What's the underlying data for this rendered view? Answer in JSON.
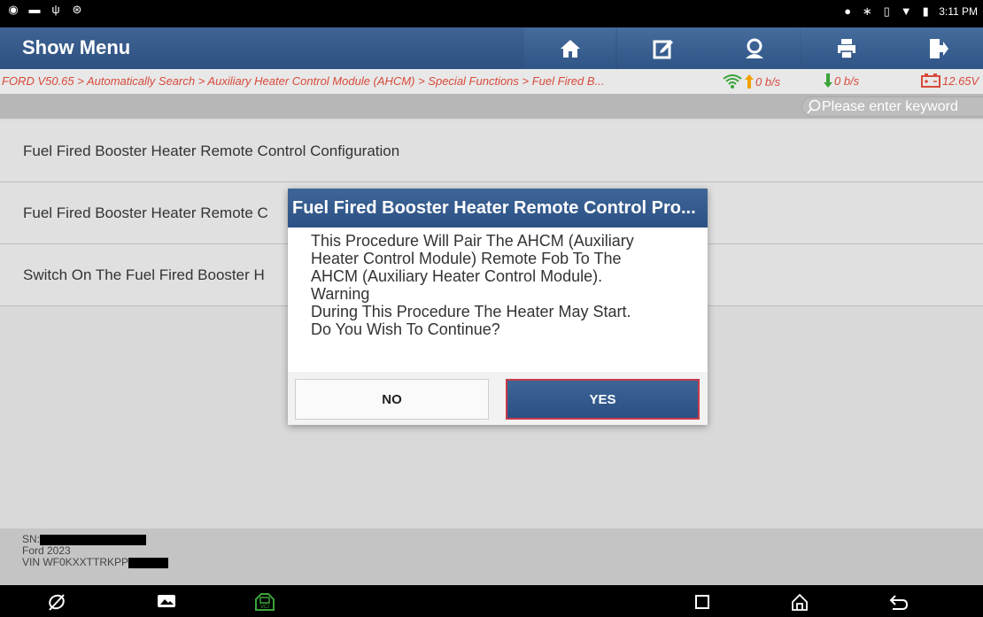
{
  "statusbar": {
    "time": "3:11 PM"
  },
  "header": {
    "title": "Show Menu",
    "buttons": [
      "home-icon",
      "edit-icon",
      "user-icon",
      "print-icon",
      "exit-icon"
    ]
  },
  "breadcrumb": {
    "path": "FORD V50.65 > Automatically Search > Auxiliary Heater Control Module (AHCM) > Special Functions > Fuel Fired B...",
    "upload": "0 b/s",
    "download": "0 b/s",
    "voltage": "12.65V"
  },
  "search": {
    "placeholder": "Please enter keyword"
  },
  "list": {
    "items": [
      {
        "label": "Fuel Fired Booster Heater Remote Control Configuration"
      },
      {
        "label": "Fuel Fired Booster Heater Remote C"
      },
      {
        "label": "Switch On The Fuel Fired Booster H"
      }
    ]
  },
  "footer": {
    "sn_label": "SN:",
    "model": "Ford  2023",
    "vin_label": "VIN WF0KXXTTRKPP"
  },
  "dialog": {
    "title": "Fuel Fired Booster Heater Remote Control Pro...",
    "line1": "This Procedure Will Pair The AHCM (Auxiliary",
    "line2": "Heater Control Module) Remote Fob To The",
    "line3": "AHCM (Auxiliary Heater Control Module).",
    "line4": "Warning",
    "line5": "During This Procedure The Heater May Start.",
    "line6": "Do You Wish To Continue?",
    "no_label": "NO",
    "yes_label": "YES"
  },
  "colors": {
    "header_blue": "#2d5080",
    "breadcrumb_red": "#d74a3b",
    "network_up": "#f2a100",
    "network_down": "#3aa33a",
    "yes_border": "#c93a48"
  }
}
